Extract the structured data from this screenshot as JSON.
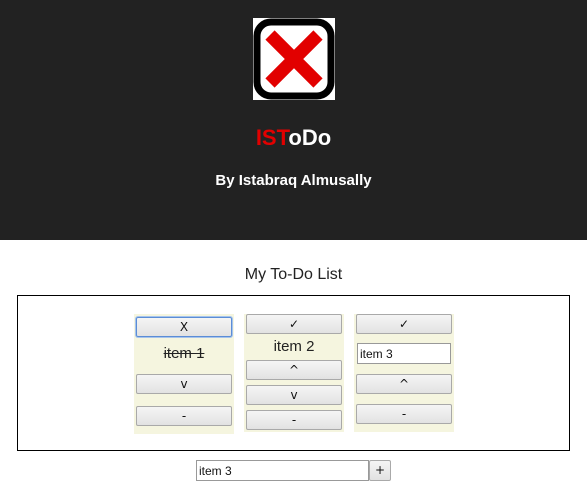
{
  "header": {
    "logo_icon": "red-x-icon",
    "brand_accent": "IST",
    "brand_rest": "oDo",
    "byline": "By Istabraq Almusally",
    "colors": {
      "background": "#222222",
      "accent": "#e20000"
    }
  },
  "list": {
    "title": "My To-Do List",
    "cards": [
      {
        "top_label": "X",
        "item_text": "item 1",
        "done": true,
        "buttons": [
          "v",
          "-"
        ]
      },
      {
        "top_label": "✓",
        "item_text": "item 2",
        "done": false,
        "buttons": [
          "^",
          "v",
          "-"
        ]
      },
      {
        "top_label": "✓",
        "item_text": "item 3",
        "editing": true,
        "buttons": [
          "^",
          "-"
        ]
      }
    ]
  },
  "new_item": {
    "value": "item 3",
    "add_label": "+"
  }
}
